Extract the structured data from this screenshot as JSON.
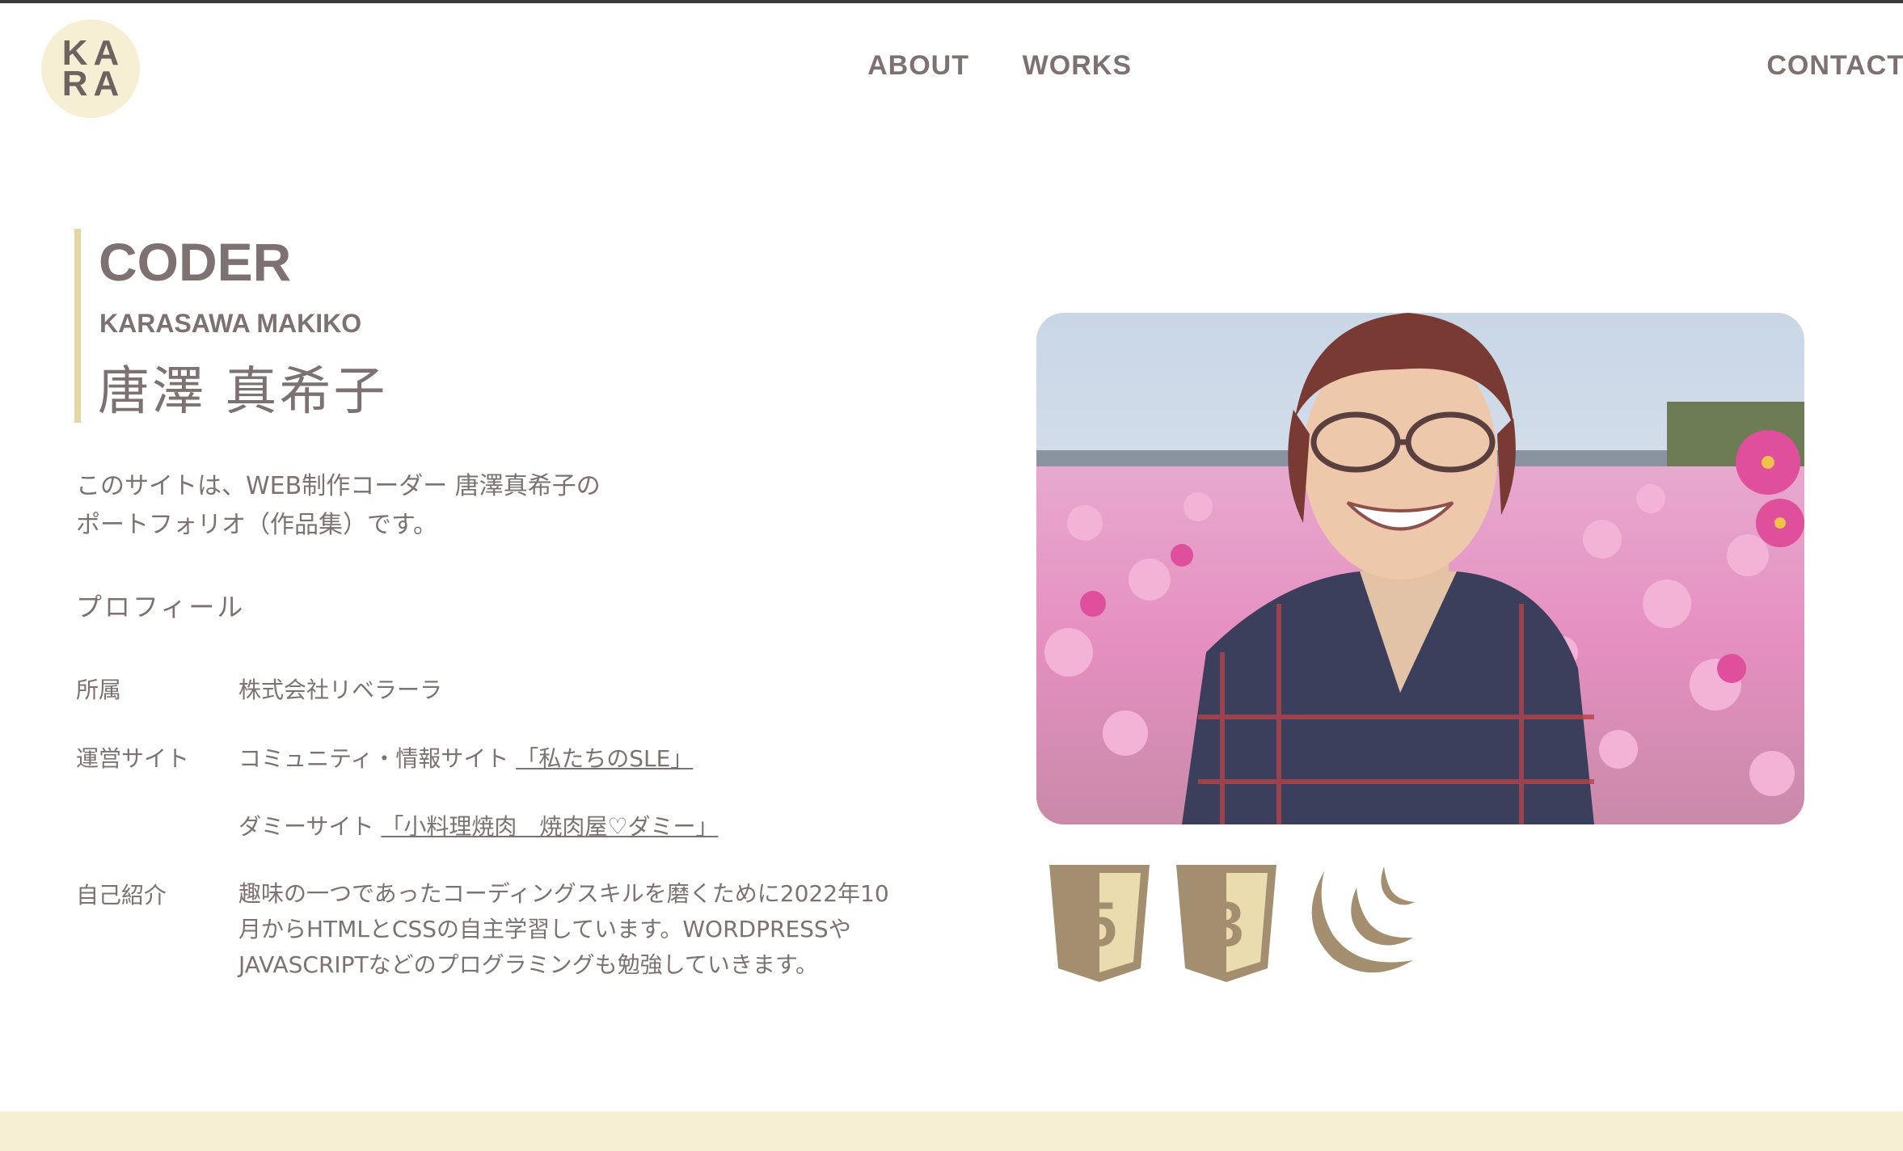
{
  "logo": {
    "line1": "KA",
    "line2": "RA"
  },
  "nav": {
    "items": [
      {
        "label": "ABOUT"
      },
      {
        "label": "WORKS"
      },
      {
        "label": "CONTACT"
      }
    ]
  },
  "hero": {
    "role": "CODER",
    "romaji": "KARASAWA MAKIKO",
    "name_kanji": "唐澤 真希子"
  },
  "intro": {
    "line1": "このサイトは、WEB制作コーダー 唐澤真希子の",
    "line2": "ポートフォリオ（作品集）です。"
  },
  "profile": {
    "heading": "プロフィール",
    "affiliation_label": "所属",
    "affiliation_value": "株式会社リベラーラ",
    "sites_label": "運営サイト",
    "site1_prefix": "コミュニティ・情報サイト ",
    "site1_link": "「私たちのSLE」",
    "site2_prefix": "ダミーサイト ",
    "site2_link": "「小料理焼肉　焼肉屋♡ダミー」",
    "bio_label": "自己紹介",
    "bio_line1": "趣味の一つであったコーディングスキルを磨くために2022年10",
    "bio_line2": "月からHTMLとCSSの自主学習しています。WORDPRESSや",
    "bio_line3": "JAVASCRIPTなどのプログラミングも勉強していきます。"
  },
  "skills": {
    "html5_digit": "5",
    "css3_digit": "3",
    "icons": [
      "html5-icon",
      "css3-icon",
      "jquery-icon"
    ]
  },
  "colors": {
    "text": "#7d7171",
    "accent_bar": "#e4d7a5",
    "cream": "#f6efd3",
    "icon_brown": "#a38f70",
    "icon_gold": "#eadcae"
  }
}
